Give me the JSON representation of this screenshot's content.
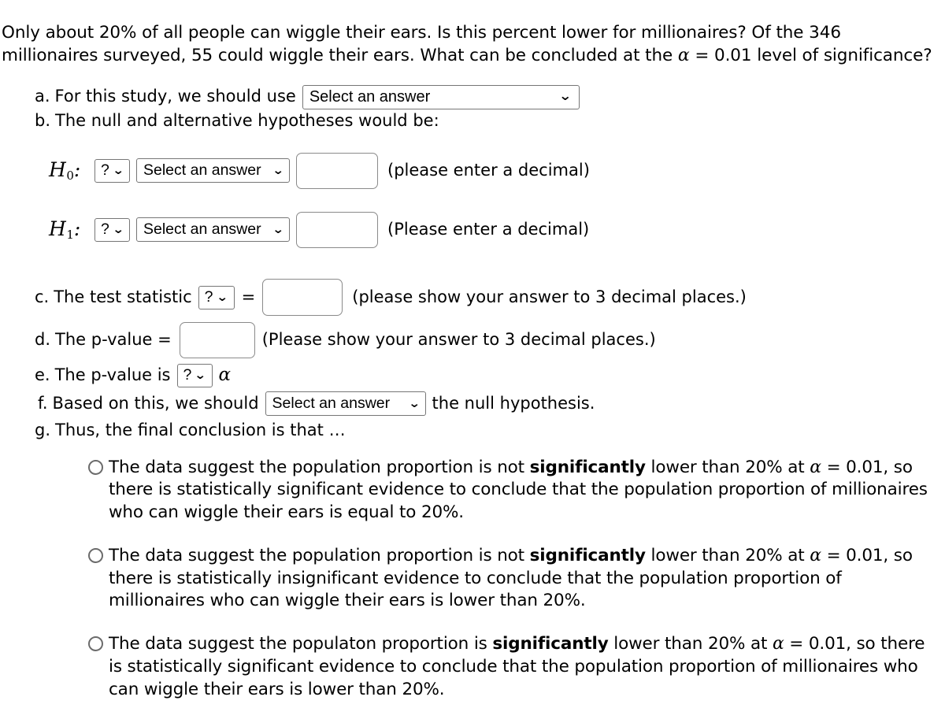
{
  "problem": {
    "intro_part1": "Only about 20% of all people can wiggle their ears. Is this percent lower for millionaires? Of the 346 millionaires surveyed, 55 could wiggle their ears. What can be concluded at the ",
    "intro_alpha": "α",
    "intro_part2": " = 0.01 level of significance?"
  },
  "parts": {
    "a": {
      "label": "a.",
      "text": "For this study, we should use",
      "select_value": "Select an answer"
    },
    "b": {
      "label": "b.",
      "text": "The null and alternative hypotheses would be:"
    },
    "c": {
      "label": "c.",
      "text": "The test statistic",
      "select_value": "?",
      "equals": "=",
      "input_value": "",
      "hint": "(please show your answer to 3 decimal places.)"
    },
    "d": {
      "label": "d.",
      "text": "The p-value =",
      "input_value": "",
      "hint": "(Please show your answer to 3 decimal places.)"
    },
    "e": {
      "label": "e.",
      "text": "The p-value is",
      "select_value": "?",
      "alpha": "α"
    },
    "f": {
      "label": "f.",
      "text": "Based on this, we should",
      "select_value": "Select an answer",
      "text_after": "the null hypothesis."
    },
    "g": {
      "label": "g.",
      "text": "Thus, the final conclusion is that …"
    }
  },
  "hypotheses": [
    {
      "name_base": "H",
      "name_sub": "0",
      "colon": ":",
      "symbol_select": "?",
      "param_select": "Select an answer",
      "input_value": "",
      "hint": "(please enter a decimal)"
    },
    {
      "name_base": "H",
      "name_sub": "1",
      "colon": ":",
      "symbol_select": "?",
      "param_select": "Select an answer",
      "input_value": "",
      "hint": "(Please enter a decimal)"
    }
  ],
  "conclusion_options": [
    {
      "pre_bold": "The data suggest the population proportion is not ",
      "bold": "significantly",
      "mid": " lower than 20% at ",
      "alpha": "α",
      "post": " = 0.01, so there is statistically significant evidence to conclude that the population proportion of millionaires who can wiggle their ears is equal to 20%.",
      "selected": false
    },
    {
      "pre_bold": "The data suggest the population proportion is not ",
      "bold": "significantly",
      "mid": " lower than 20% at ",
      "alpha": "α",
      "post": " = 0.01, so there is statistically insignificant evidence to conclude that the population proportion of millionaires who can wiggle their ears is lower than 20%.",
      "selected": false
    },
    {
      "pre_bold": "The data suggest the populaton proportion is ",
      "bold": "significantly",
      "mid": " lower than 20% at ",
      "alpha": "α",
      "post": " = 0.01, so there is statistically significant evidence to conclude that the population proportion of millionaires who can wiggle their ears is lower than 20%.",
      "selected": false
    }
  ],
  "icons": {
    "chevron_down": "⌄",
    "chevron_glyph": "❯"
  },
  "colors": {
    "text": "#000000",
    "background": "#ffffff",
    "control_border": "#767676",
    "input_border": "#8a8a8a",
    "radio_border": "#6b6b6b"
  }
}
